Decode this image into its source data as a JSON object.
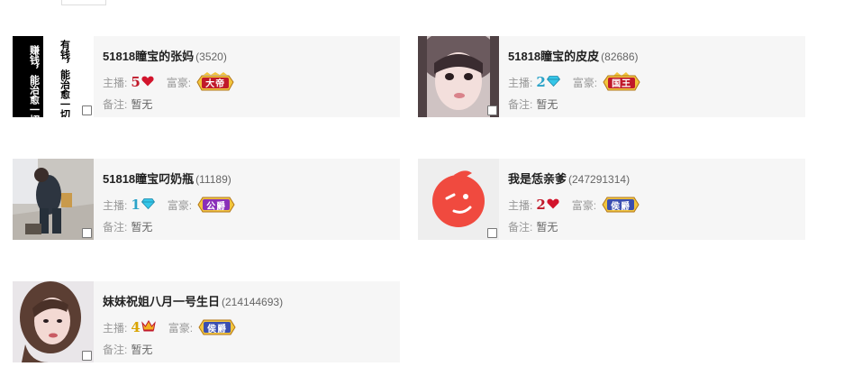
{
  "labels": {
    "anchor": "主播:",
    "rich": "富豪:",
    "note": "备注:"
  },
  "cards": [
    {
      "name": "51818瞳宝的张妈",
      "uid": "(3520)",
      "level": "5",
      "level_icon": "heart-icon",
      "level_color": "#c0192a",
      "rich_badge": "大帝",
      "rich_badge_color": "#c0192a",
      "note": "暂无",
      "avatar_text": [
        "有钱，能治愈一切",
        "赚钱，能治愈一切烦"
      ]
    },
    {
      "name": "51818瞳宝的皮皮",
      "uid": "(82686)",
      "level": "2",
      "level_icon": "diamond-icon",
      "level_color": "#2ba3c8",
      "rich_badge": "国王",
      "rich_badge_color": "#c0192a",
      "note": "暂无"
    },
    {
      "name": "51818瞳宝叼奶瓶",
      "uid": "(11189)",
      "level": "1",
      "level_icon": "diamond-icon",
      "level_color": "#2ba3c8",
      "rich_badge": "公爵",
      "rich_badge_color": "#8a2fb8",
      "note": "暂无"
    },
    {
      "name": "我是恁亲爹",
      "uid": "(247291314)",
      "level": "2",
      "level_icon": "heart-icon",
      "level_color": "#c0192a",
      "rich_badge": "侯爵",
      "rich_badge_color": "#3b4fb0",
      "note": "暂无"
    },
    {
      "name": "妹妹祝姐八月一号生日",
      "uid": "(214144693)",
      "level": "4",
      "level_icon": "crown-icon",
      "level_color": "#d9a400",
      "rich_badge": "侯爵",
      "rich_badge_color": "#3b4fb0",
      "note": "暂无"
    }
  ]
}
